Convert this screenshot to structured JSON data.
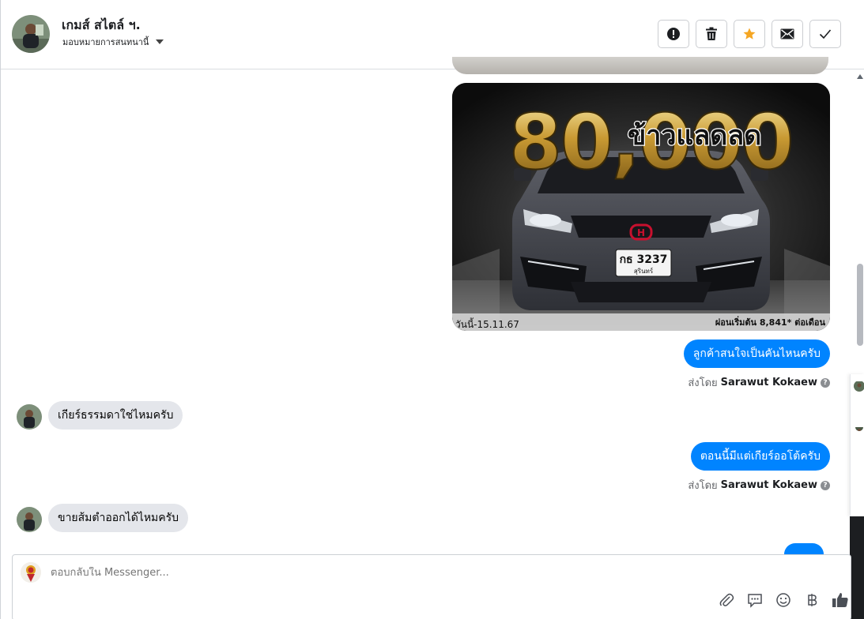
{
  "header": {
    "contact_name": "เกมส์ สไตล์ ฯ.",
    "assign_label": "มอบหมายการสนทนานี้",
    "actions": [
      {
        "name": "mark-spam-button",
        "icon": "exclamation-icon"
      },
      {
        "name": "delete-button",
        "icon": "trash-icon"
      },
      {
        "name": "star-button",
        "icon": "star-icon",
        "color": "#f5a623"
      },
      {
        "name": "mark-unread-button",
        "icon": "envelope-icon"
      },
      {
        "name": "mark-done-button",
        "icon": "check-icon"
      }
    ]
  },
  "image_ad": {
    "big_number": "80,000",
    "headline": "ข้าวแลดลด",
    "plate_number": "กธ 3237",
    "plate_province": "สุรินทร์",
    "date_text": "วันนี้-15.11.67",
    "installment_text": "ผ่อนเริ่มต้น 8,841* ต่อเดือน"
  },
  "messages": {
    "out_1": "ลูกค้าสนใจเป็นคันไหนครับ",
    "sent_by_1_prefix": "ส่งโดย",
    "sent_by_1_name": "Sarawut Kokaew",
    "in_1": "เกียร์ธรรมดาใช่ไหมครับ",
    "out_2": "ตอนนี้มีแต่เกียร์ออโต้ครับ",
    "sent_by_2_prefix": "ส่งโดย",
    "sent_by_2_name": "Sarawut Kokaew",
    "in_2": "ขายส้มตำออกได้ไหมครับ"
  },
  "composer": {
    "placeholder": "ตอบกลับใน Messenger...",
    "tools": [
      "paperclip-icon",
      "saved-reply-icon",
      "emoji-icon",
      "baht-icon",
      "thumbs-up-icon"
    ]
  },
  "colors": {
    "accent": "#0084ff",
    "incoming_bubble": "#e4e6eb",
    "star": "#f5a623"
  }
}
